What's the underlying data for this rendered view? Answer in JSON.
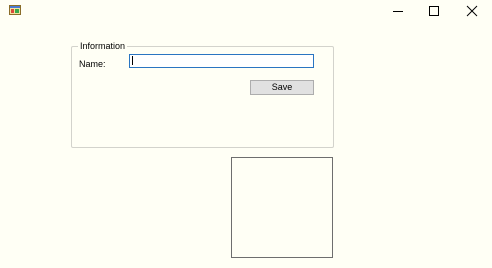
{
  "window": {
    "icon": "app-icon",
    "controls": {
      "minimize_icon": "minimize-icon",
      "maximize_icon": "maximize-icon",
      "close_icon": "close-icon"
    }
  },
  "form": {
    "group_title": "Information",
    "name_label": "Name:",
    "name_value": "",
    "save_label": "Save"
  },
  "colors": {
    "background": "#fffff5",
    "input_focus_border": "#2a75c2",
    "button_face": "#e1e1e1",
    "group_border": "#d3d3cc",
    "picture_border": "#6e6e6e"
  }
}
